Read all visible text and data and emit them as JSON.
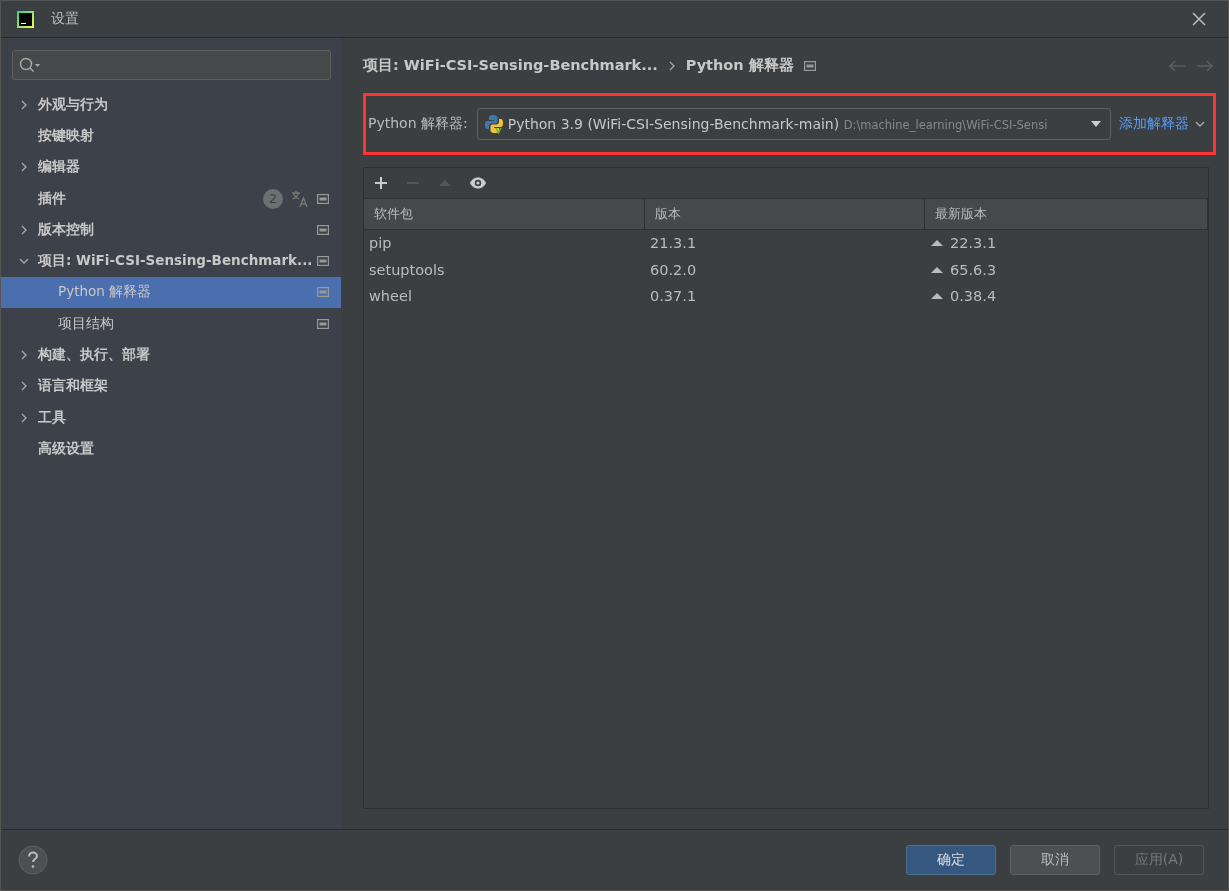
{
  "window": {
    "title": "设置"
  },
  "sidebar": {
    "items": [
      {
        "label": "外观与行为",
        "expanded": false,
        "selected": false
      },
      {
        "label": "按键映射",
        "selected": false
      },
      {
        "label": "编辑器",
        "expanded": false,
        "selected": false
      },
      {
        "label": "插件",
        "selected": false,
        "scope_icon": true,
        "badge": "2",
        "translate_icon": true
      },
      {
        "label": "版本控制",
        "expanded": false,
        "selected": false,
        "scope_icon": true
      },
      {
        "label": "项目: WiFi-CSI-Sensing-Benchmark...",
        "expanded": true,
        "selected": false,
        "scope_icon": true,
        "children": [
          {
            "label": "Python 解释器",
            "selected": true,
            "scope_icon": true
          },
          {
            "label": "项目结构",
            "selected": false,
            "scope_icon": true
          }
        ]
      },
      {
        "label": "构建、执行、部署",
        "expanded": false,
        "selected": false
      },
      {
        "label": "语言和框架",
        "expanded": false,
        "selected": false
      },
      {
        "label": "工具",
        "expanded": false,
        "selected": false
      },
      {
        "label": "高级设置",
        "selected": false
      }
    ]
  },
  "breadcrumb": [
    "项目: WiFi-CSI-Sensing-Benchmark...",
    "Python 解释器"
  ],
  "interpreter": {
    "label": "Python 解释器:",
    "value": "Python 3.9 (WiFi-CSI-Sensing-Benchmark-main)",
    "path": "D:\\machine_learning\\WiFi-CSI-Sensi",
    "add_link": "添加解释器",
    "highlighted": true
  },
  "toolbar": [
    {
      "kind": "add",
      "disabled": false
    },
    {
      "kind": "remove",
      "disabled": true
    },
    {
      "kind": "upgrade",
      "disabled": true
    },
    {
      "kind": "show",
      "disabled": false
    }
  ],
  "table": {
    "columns": [
      "软件包",
      "版本",
      "最新版本"
    ],
    "rows": [
      {
        "package": "pip",
        "version": "21.3.1",
        "latest": "22.3.1",
        "upgradable": true
      },
      {
        "package": "setuptools",
        "version": "60.2.0",
        "latest": "65.6.3",
        "upgradable": true
      },
      {
        "package": "wheel",
        "version": "0.37.1",
        "latest": "0.38.4",
        "upgradable": true
      }
    ]
  },
  "buttons": [
    {
      "label": "确定",
      "kind": "primary",
      "disabled": false
    },
    {
      "label": "取消",
      "kind": "normal",
      "disabled": false
    },
    {
      "label": "应用(A)",
      "kind": "normal",
      "disabled": true
    }
  ]
}
